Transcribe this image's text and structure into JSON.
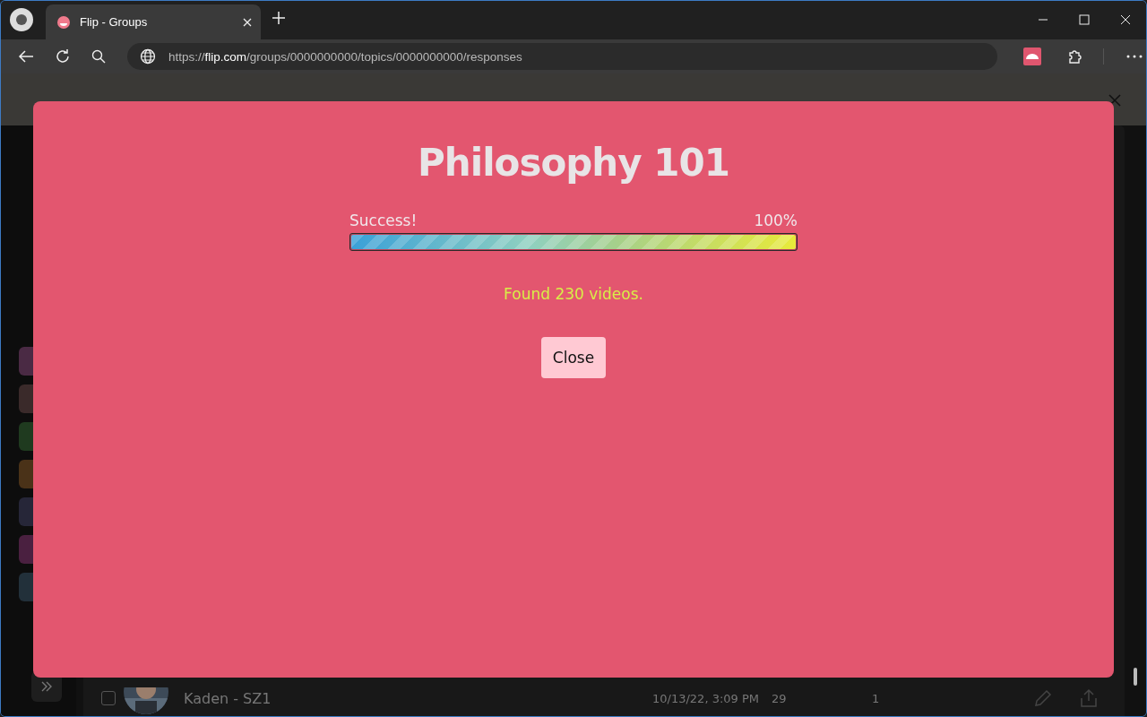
{
  "browser": {
    "tabs": [
      {
        "title": "Flip - Groups",
        "selected": true
      }
    ],
    "url": {
      "scheme": "https://",
      "host": "flip.com",
      "path": "/groups/0000000000/topics/0000000000/responses"
    }
  },
  "modal": {
    "title": "Philosophy 101",
    "status": "Success!",
    "percent": "100%",
    "level": 1,
    "message": "Found 230 videos.",
    "button": "Close"
  },
  "rows": [
    {
      "name": "Kaden - SZ1",
      "date": "10/13/22, 3:09 PM",
      "count": "29",
      "column_5": "1",
      "checked": false
    }
  ]
}
